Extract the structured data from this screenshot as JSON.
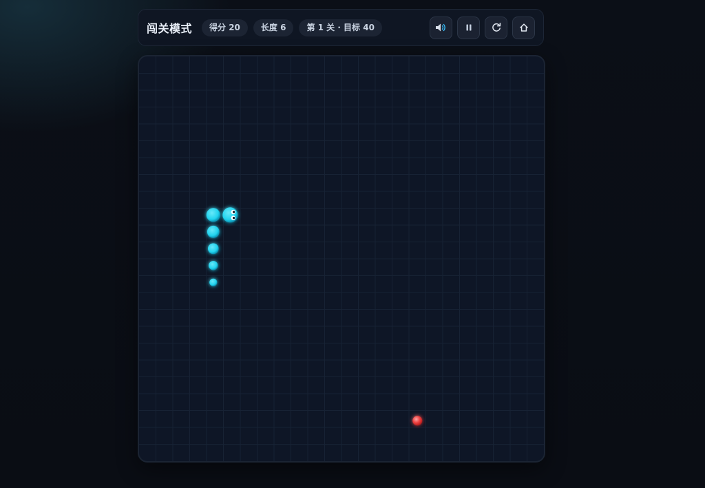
{
  "topbar": {
    "title": "闯关模式",
    "score_label": "得分 20",
    "length_label": "长度 6",
    "level_label": "第 1 关 · 目标 40"
  },
  "controls": [
    {
      "name": "sound-button",
      "icon": "speaker-icon"
    },
    {
      "name": "pause-button",
      "icon": "pause-icon"
    },
    {
      "name": "restart-button",
      "icon": "restart-icon"
    },
    {
      "name": "home-button",
      "icon": "home-icon"
    }
  ],
  "game": {
    "mode": "level",
    "score": 20,
    "length": 6,
    "level": 1,
    "target_score": 40,
    "grid_cols": 24,
    "grid_rows": 24,
    "snake": [
      {
        "col": 5.4,
        "row": 9.4
      },
      {
        "col": 4.4,
        "row": 9.4
      },
      {
        "col": 4.4,
        "row": 10.4
      },
      {
        "col": 4.4,
        "row": 11.4
      },
      {
        "col": 4.4,
        "row": 12.4
      },
      {
        "col": 4.4,
        "row": 13.4
      }
    ],
    "snake_direction": "right",
    "food": {
      "col": 16.5,
      "row": 21.6
    },
    "colors": {
      "background": "#0e1626",
      "grid_line": "#172234",
      "snake": "#22d3ee",
      "food": "#ef4444"
    }
  }
}
